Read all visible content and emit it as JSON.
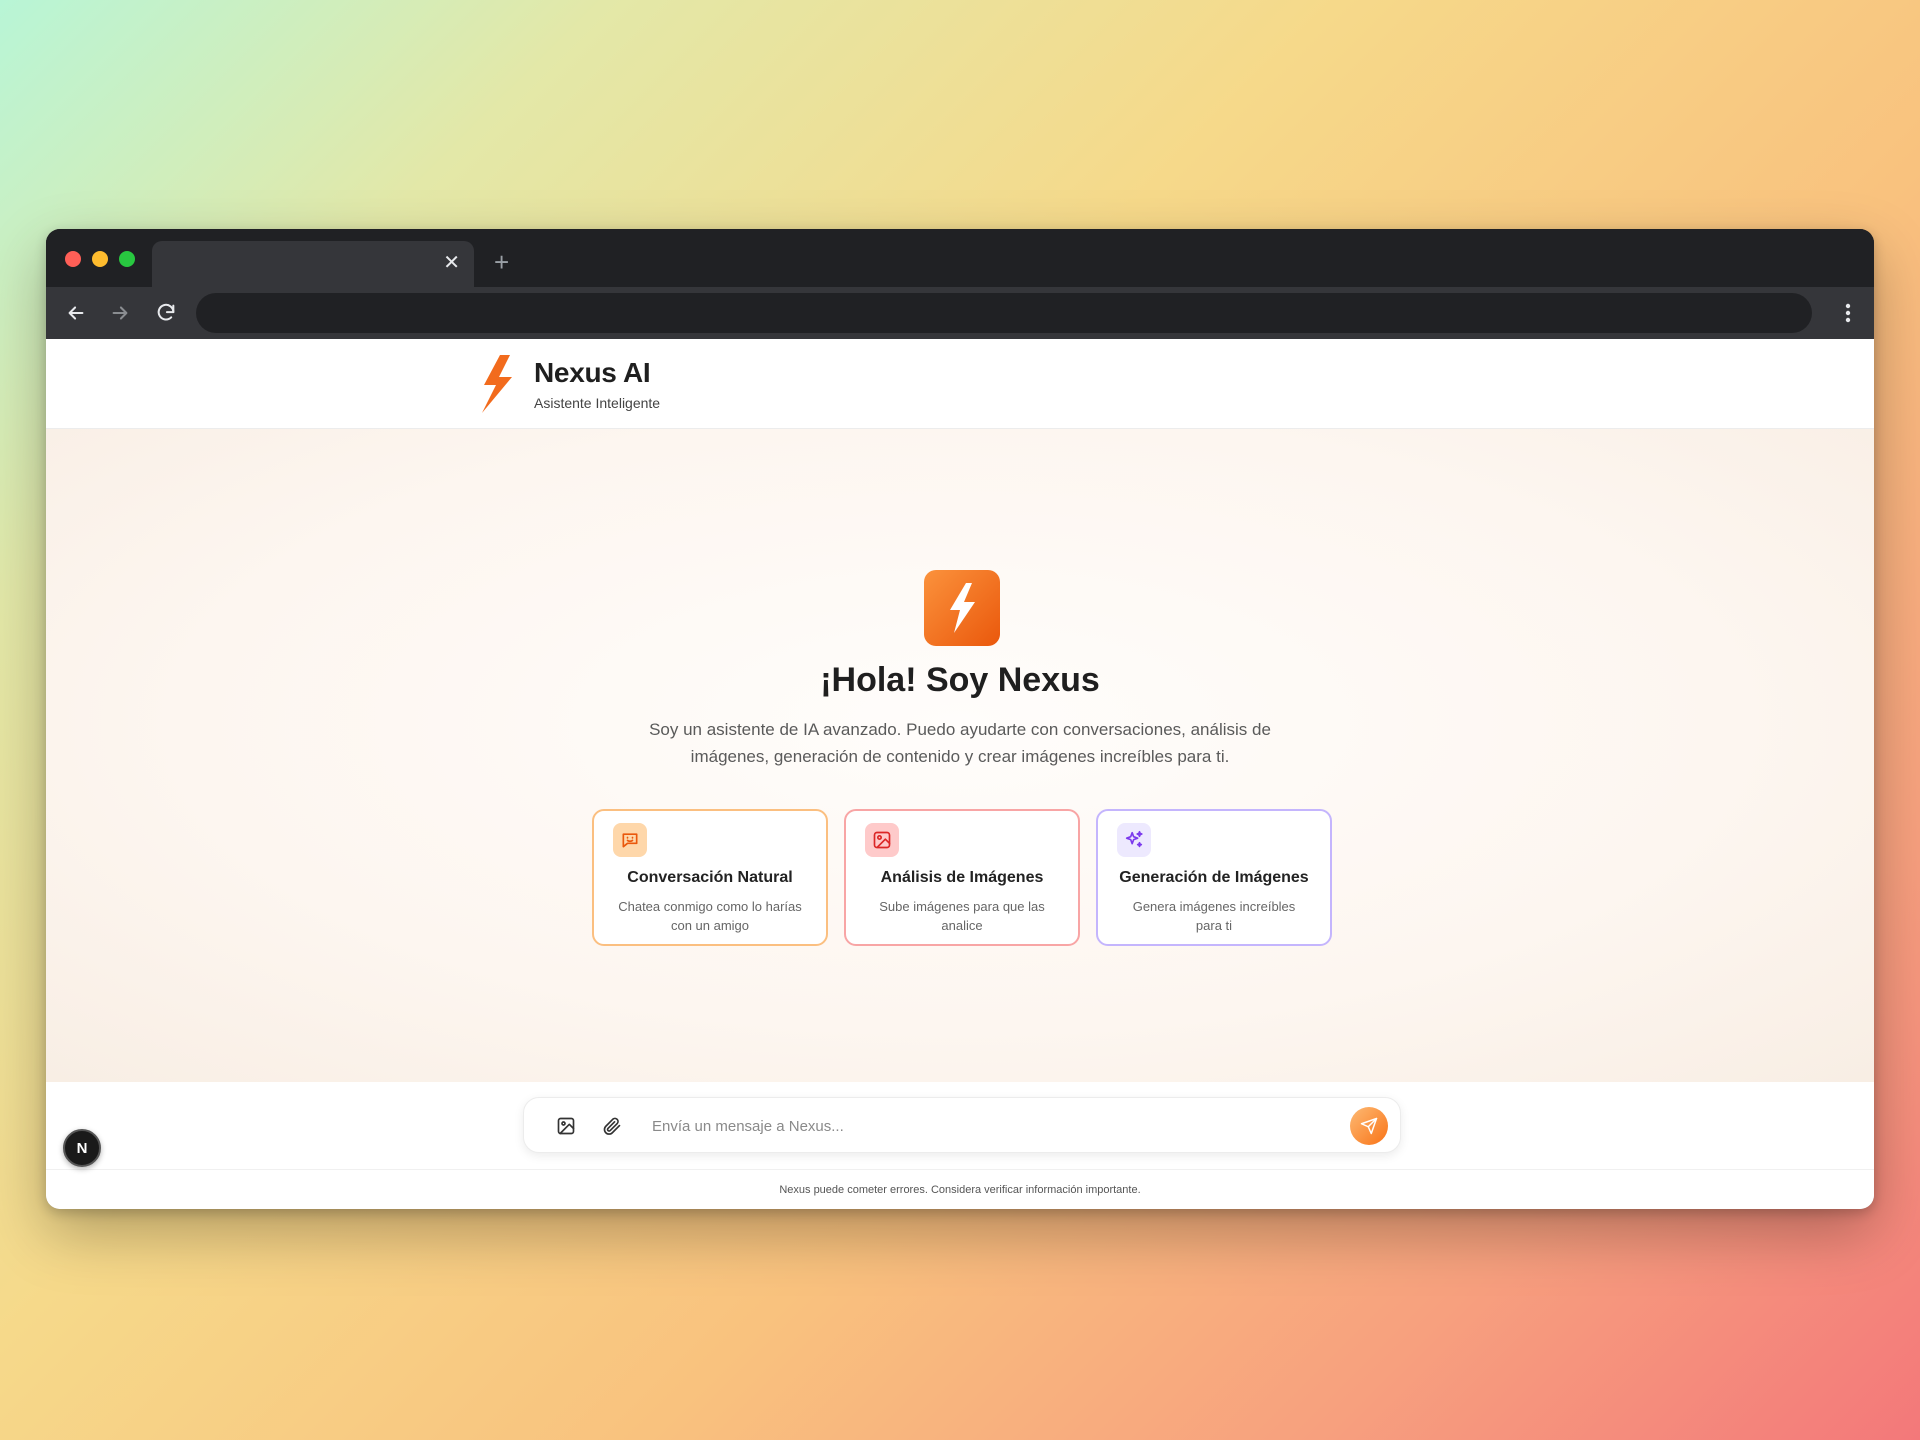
{
  "browser": {
    "tab_close": "✕",
    "new_tab": "+"
  },
  "app": {
    "name": "Nexus AI",
    "tagline": "Asistente Inteligente",
    "brand_color": "#f97316"
  },
  "hero": {
    "title": "¡Hola! Soy Nexus",
    "description": "Soy un asistente de IA avanzado. Puedo ayudarte con conversaciones, análisis de imágenes, generación de contenido y crear imágenes increíbles para ti."
  },
  "features": [
    {
      "icon": "chat-bubble-icon",
      "title": "Conversación Natural",
      "description": "Chatea conmigo como lo harías con un amigo",
      "accent": "#fbbf80"
    },
    {
      "icon": "image-icon",
      "title": "Análisis de Imágenes",
      "description": "Sube imágenes para que las analice",
      "accent": "#f8a5a5"
    },
    {
      "icon": "sparkles-icon",
      "title": "Generación de Imágenes",
      "description": "Genera imágenes increíbles para ti",
      "accent": "#c4b5fd"
    }
  ],
  "composer": {
    "placeholder": "Envía un mensaje a Nexus..."
  },
  "footer": {
    "disclaimer": "Nexus puede cometer errores. Considera verificar información importante."
  },
  "badge": {
    "letter": "N"
  }
}
